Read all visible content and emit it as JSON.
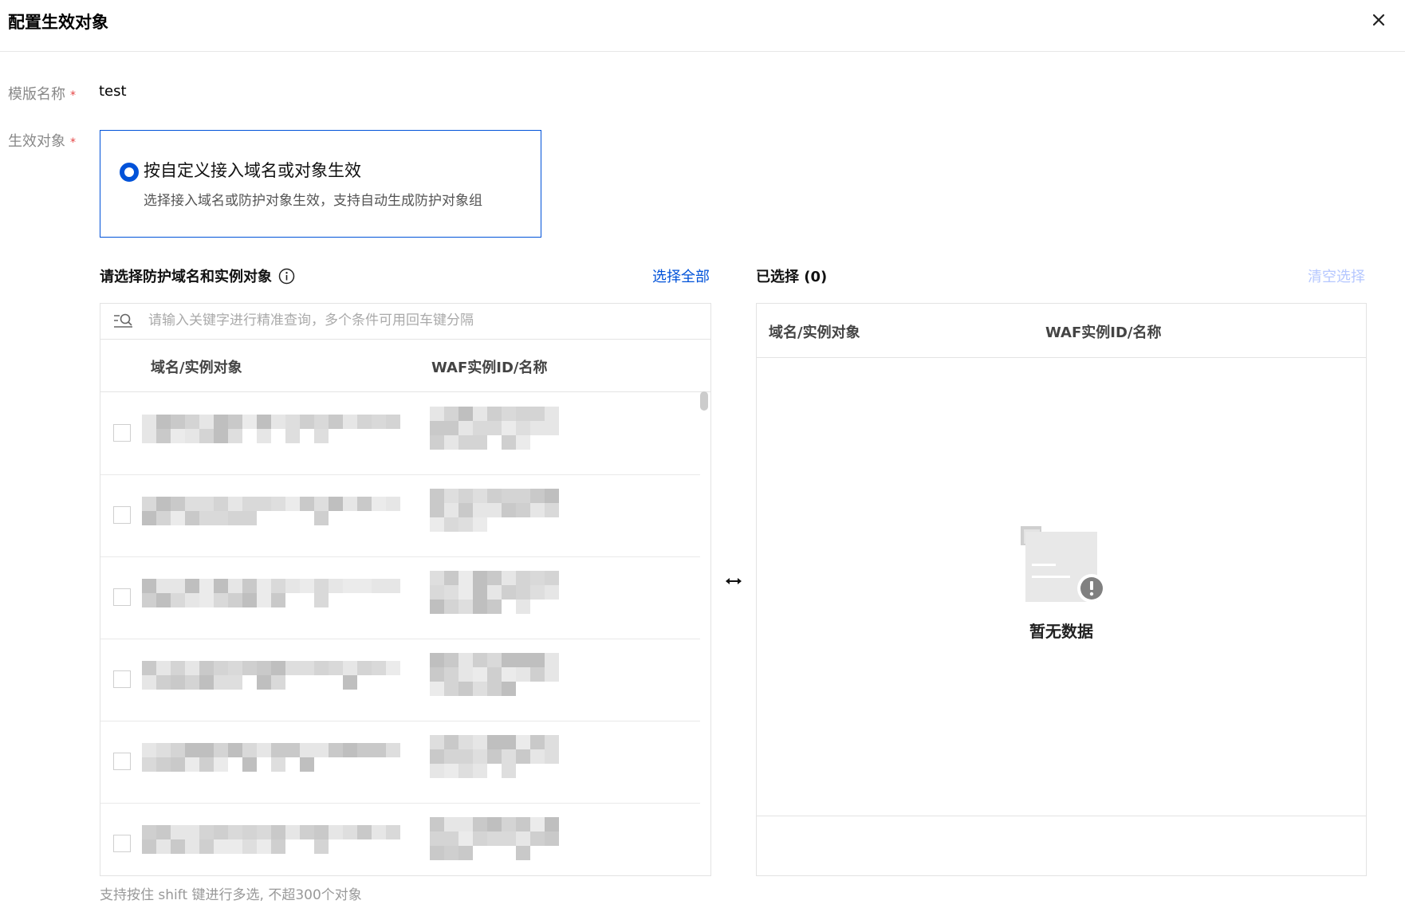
{
  "dialog": {
    "title": "配置生效对象"
  },
  "form": {
    "template_name_label": "模版名称",
    "template_name_value": "test",
    "effective_target_label": "生效对象",
    "required_mark": "*"
  },
  "radio_option": {
    "title": "按自定义接入域名或对象生效",
    "description": "选择接入域名或防护对象生效，支持自动生成防护对象组",
    "selected": true
  },
  "left_panel": {
    "title": "请选择防护域名和实例对象",
    "select_all_label": "选择全部",
    "search_placeholder": "请输入关键字进行精准查询，多个条件可用回车键分隔",
    "columns": [
      "域名/实例对象",
      "WAF实例ID/名称"
    ],
    "row_count_visible": 6
  },
  "right_panel": {
    "title": "已选择 (0)",
    "clear_label": "清空选择",
    "columns": [
      "域名/实例对象",
      "WAF实例ID/名称"
    ],
    "empty_text": "暂无数据"
  },
  "hint": "支持按住 shift 键进行多选, 不超300个对象",
  "colors": {
    "primary": "#0052d9",
    "required": "#e54545",
    "disabled_link": "#b5c7ff",
    "border": "#e3e3e3"
  },
  "icons": [
    "close-icon",
    "info-icon",
    "search-icon",
    "swap-arrows-icon",
    "empty-data-icon"
  ]
}
